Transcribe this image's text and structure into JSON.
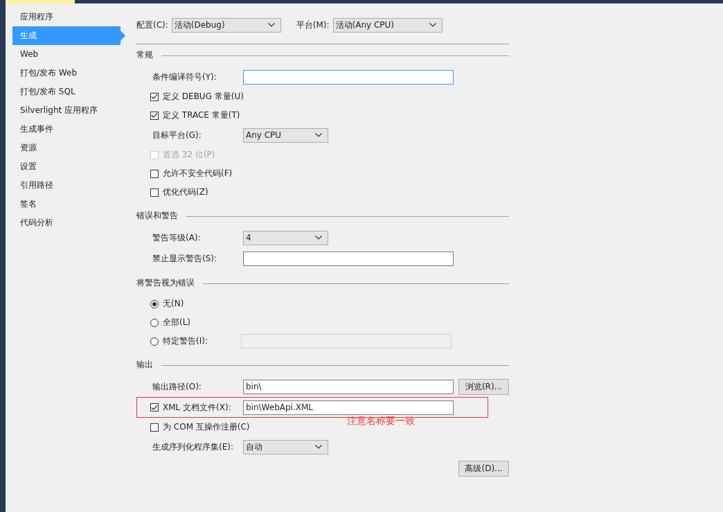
{
  "sidebar": {
    "items": [
      {
        "label": "应用程序",
        "selected": false
      },
      {
        "label": "生成",
        "selected": true
      },
      {
        "label": "Web",
        "selected": false
      },
      {
        "label": "打包/发布 Web",
        "selected": false
      },
      {
        "label": "打包/发布 SQL",
        "selected": false
      },
      {
        "label": "Silverlight 应用程序",
        "selected": false
      },
      {
        "label": "生成事件",
        "selected": false
      },
      {
        "label": "资源",
        "selected": false
      },
      {
        "label": "设置",
        "selected": false
      },
      {
        "label": "引用路径",
        "selected": false
      },
      {
        "label": "签名",
        "selected": false
      },
      {
        "label": "代码分析",
        "selected": false
      }
    ]
  },
  "toolbar": [
    {
      "label": "配置(C):",
      "value": "活动(Debug)"
    },
    {
      "label": "平台(M):",
      "value": "活动(Any CPU)"
    }
  ],
  "sections": [
    {
      "title": "常规",
      "rows": [
        {
          "kind": "text",
          "label": "条件编译符号(Y):",
          "focused": true
        },
        {
          "kind": "check",
          "label": "定义 DEBUG 常量(U)",
          "checked": true,
          "disabled": false
        },
        {
          "kind": "check",
          "label": "定义 TRACE 常量(T)",
          "checked": true,
          "disabled": false
        },
        {
          "kind": "select",
          "label": "目标平台(G):",
          "value": "Any CPU"
        },
        {
          "kind": "check",
          "label": "首选 32 位(P)",
          "checked": false,
          "disabled": true
        },
        {
          "kind": "check",
          "label": "允许不安全代码(F)",
          "checked": false,
          "disabled": false
        },
        {
          "kind": "check",
          "label": "优化代码(Z)",
          "checked": false,
          "disabled": false
        }
      ]
    },
    {
      "title": "错误和警告",
      "rows": [
        {
          "kind": "select",
          "label": "警告等级(A):",
          "value": "4"
        },
        {
          "kind": "text",
          "label": "禁止显示警告(S):",
          "focused": false
        }
      ]
    },
    {
      "title": "将警告视为错误",
      "rows": [
        {
          "kind": "radio",
          "label": "无(N)",
          "selected": true
        },
        {
          "kind": "radio",
          "label": "全部(L)",
          "selected": false
        },
        {
          "kind": "radio",
          "label": "特定警告(I):",
          "selected": false,
          "field_disabled": true
        }
      ]
    },
    {
      "title": "输出",
      "rows": [
        {
          "kind": "text",
          "label": "输出路径(O):",
          "value": "bin\\",
          "focused": false,
          "button": "浏览(R)..."
        },
        {
          "kind": "checktext",
          "label": "XML 文档文件(X):",
          "checked": true,
          "value": "bin\\WebApi.XML",
          "highlighted": true,
          "annotation": "注意名称要一致"
        },
        {
          "kind": "check",
          "label": "为 COM 互操作注册(C)",
          "checked": false,
          "disabled": false
        },
        {
          "kind": "select",
          "label": "生成序列化程序集(E):",
          "value": "自动"
        },
        {
          "kind": "button",
          "button": "高级(D)..."
        }
      ]
    }
  ]
}
